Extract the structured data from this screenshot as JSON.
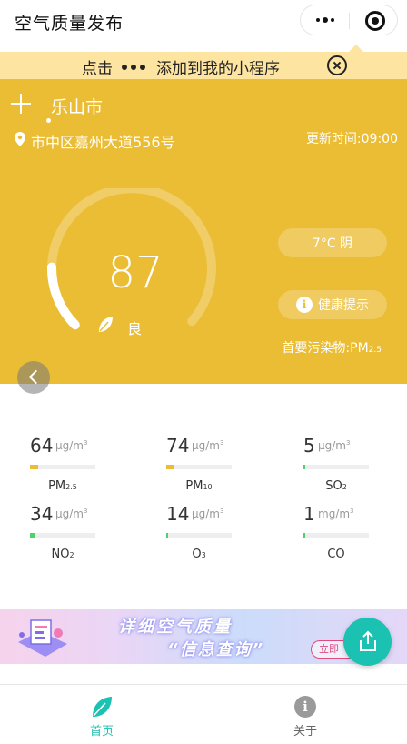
{
  "navbar": {
    "title": "空气质量发布",
    "more_icon": "more-dots-icon",
    "close_icon": "target-circle-icon"
  },
  "tip": {
    "prefix": "点击",
    "suffix": "添加到我的小程序",
    "close_icon": "close-circle-icon"
  },
  "header": {
    "add_icon": "plus-icon",
    "city": "乐山市",
    "pin_icon": "location-pin-icon",
    "address": "市中区嘉州大道556号",
    "update_time": "更新时间:09:00",
    "aqi": "87",
    "aqi_level": "良",
    "aqi_gauge_fraction": 0.17,
    "weather": "7°C 阴",
    "health_tip": "健康提示",
    "primary_pollutant_label": "首要污染物:PM",
    "primary_pollutant_sub": "2.5",
    "back_icon": "chevron-left-icon",
    "colors": {
      "background": "#ebbd35",
      "text": "#ffffff"
    }
  },
  "pollutants": [
    {
      "value": "64",
      "unit": "μg/m",
      "unit_sup": "3",
      "name": "PM",
      "name_sub": "2.5",
      "level_fraction": 0.12,
      "color": "#ebbd35"
    },
    {
      "value": "74",
      "unit": "μg/m",
      "unit_sup": "3",
      "name": "PM",
      "name_sub": "10",
      "level_fraction": 0.12,
      "color": "#ebbd35"
    },
    {
      "value": "5",
      "unit": "μg/m",
      "unit_sup": "3",
      "name": "SO",
      "name_sub": "2",
      "level_fraction": 0.02,
      "color": "#4cd26b"
    },
    {
      "value": "34",
      "unit": "μg/m",
      "unit_sup": "3",
      "name": "NO",
      "name_sub": "2",
      "level_fraction": 0.07,
      "color": "#4cd26b"
    },
    {
      "value": "14",
      "unit": "μg/m",
      "unit_sup": "3",
      "name": "O",
      "name_sub": "3",
      "level_fraction": 0.03,
      "color": "#4cd26b"
    },
    {
      "value": "1",
      "unit": "mg/m",
      "unit_sup": "3",
      "name": "CO",
      "name_sub": "",
      "level_fraction": 0.01,
      "color": "#4cd26b"
    }
  ],
  "banner": {
    "line1": "详细空气质量",
    "line2": "“信息查询”",
    "button": "立即",
    "share_icon": "share-icon"
  },
  "tabbar": {
    "home_label": "首页",
    "home_icon": "leaf-icon",
    "about_label": "关于",
    "about_icon": "info-icon",
    "active_color": "#1cc2b1"
  }
}
